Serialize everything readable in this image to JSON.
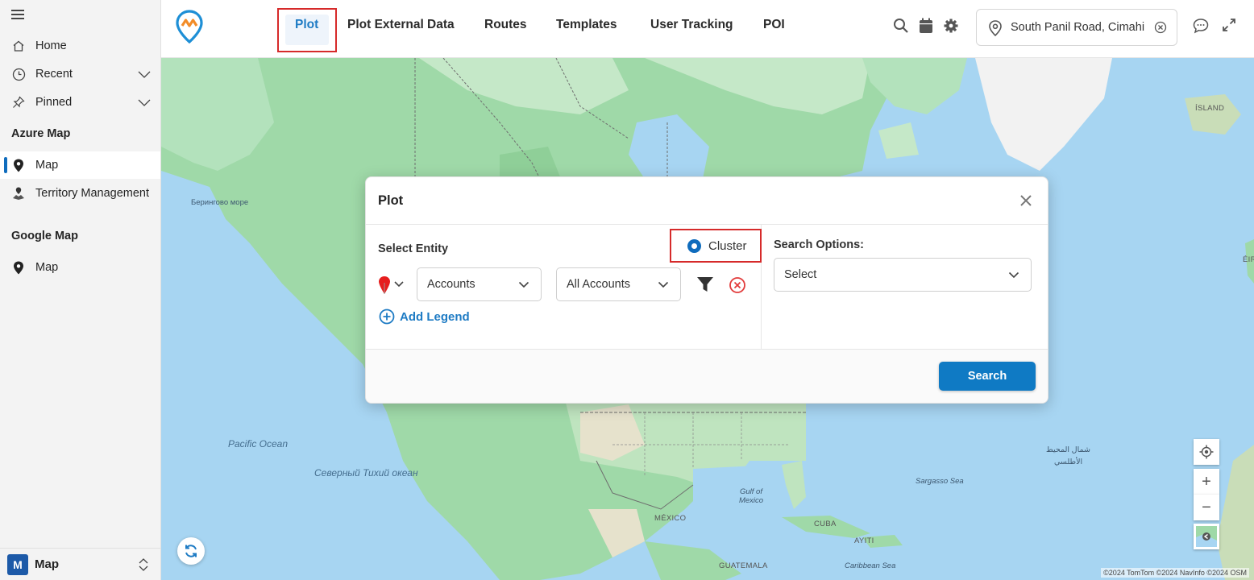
{
  "sidebar": {
    "items": [
      {
        "label": "Home",
        "icon": "home-icon"
      },
      {
        "label": "Recent",
        "icon": "clock-icon"
      },
      {
        "label": "Pinned",
        "icon": "pin-icon"
      }
    ],
    "groups": [
      {
        "title": "Azure Map",
        "items": [
          {
            "label": "Map",
            "icon": "map-pin-icon"
          },
          {
            "label": "Territory Management",
            "icon": "territory-icon"
          }
        ]
      },
      {
        "title": "Google Map",
        "items": [
          {
            "label": "Map",
            "icon": "map-pin-icon"
          }
        ]
      }
    ],
    "footer": {
      "badge": "M",
      "label": "Map"
    }
  },
  "topbar": {
    "tabs": [
      "Plot",
      "Plot External Data",
      "Routes",
      "Templates",
      "User Tracking",
      "POI"
    ],
    "active_tab": "Plot",
    "location": "South Panil Road, Cimahi",
    "accent": "#1e7bc4"
  },
  "map": {
    "labels": {
      "bering": "Берингово море",
      "pacific": "Pacific Ocean",
      "north_pacific": "Северный Тихий океан",
      "gulf": "Gulf of Mexico",
      "mexico": "MÉXICO",
      "cuba": "CUBA",
      "haiti": "AYITI",
      "guatemala": "GUATEMALA",
      "caribbean": "Caribbean Sea",
      "sargasso": "Sargasso Sea",
      "iceland": "ÍSLAND",
      "eire": "ÉIR",
      "atlantic_ar_1": "شمال المحيط",
      "atlantic_ar_2": "الأطلسي"
    },
    "attribution": "©2024 TomTom ©2024 NavInfo ©2024 OSM",
    "controls": {
      "zoom_in": "+",
      "zoom_out": "−"
    }
  },
  "dialog": {
    "title": "Plot",
    "select_entity_label": "Select Entity",
    "cluster_label": "Cluster",
    "cluster_checked": true,
    "entity_select": "Accounts",
    "view_select": "All Accounts",
    "add_legend": "Add Legend",
    "search_options_label": "Search Options:",
    "search_options_select": "Select",
    "search_button": "Search"
  }
}
